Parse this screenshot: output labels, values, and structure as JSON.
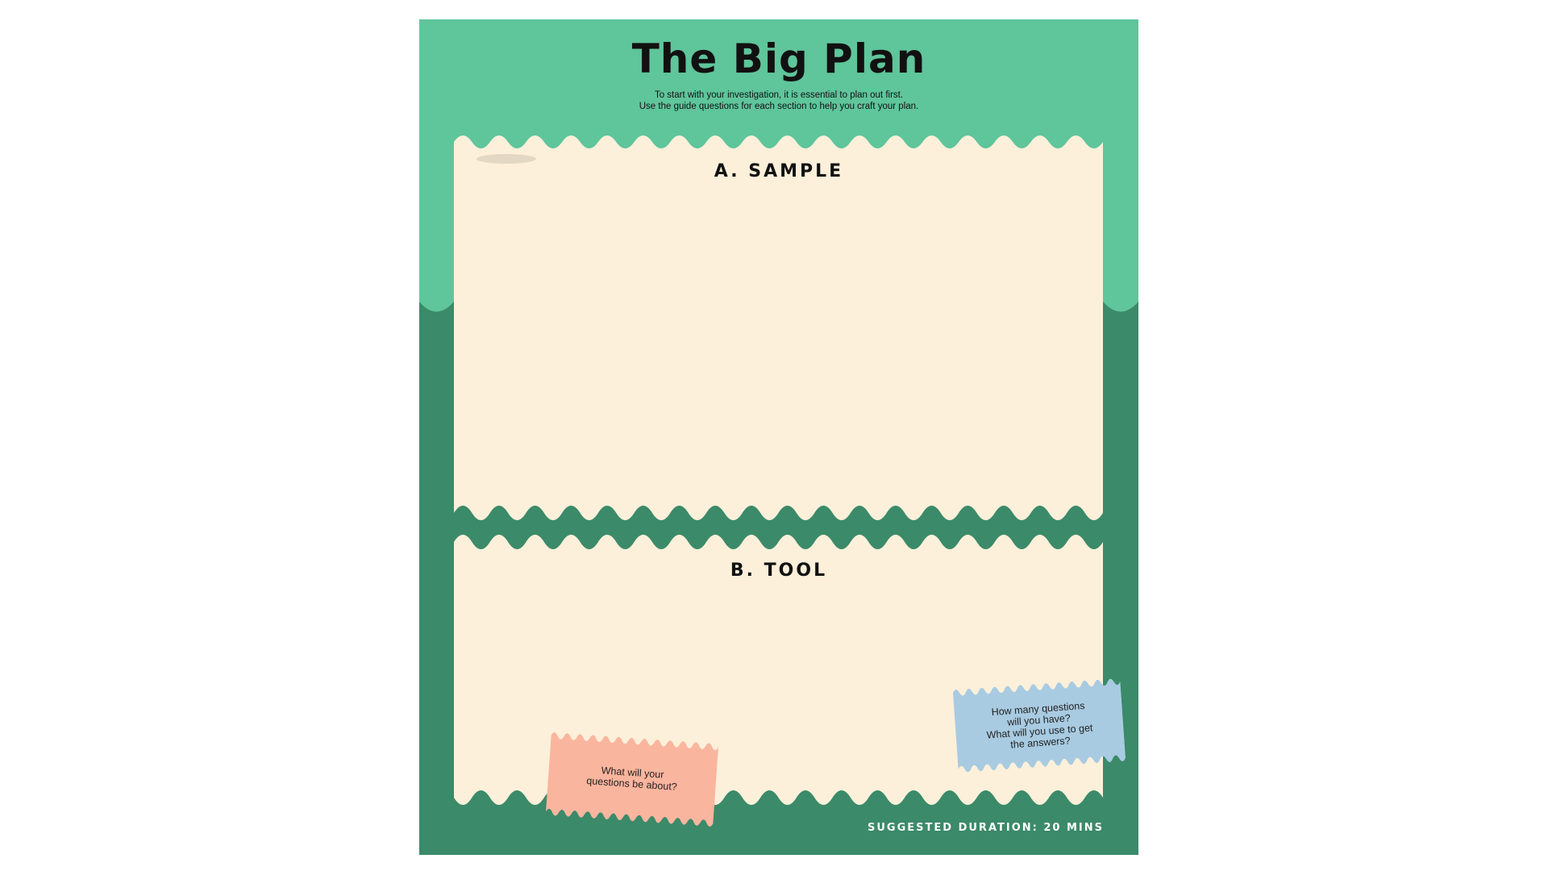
{
  "document": {
    "title": "The Big Plan",
    "intro_lines": [
      "To start with your investigation, it is essential to plan out first.",
      "Use the guide questions for each section to help you craft your plan."
    ],
    "sections": [
      {
        "label": "A. SAMPLE"
      },
      {
        "label": "B. TOOL"
      }
    ],
    "notes": {
      "pink": {
        "lines": [
          "What will your",
          "questions be about?"
        ]
      },
      "blue": {
        "lines": [
          "How many questions",
          "will you have?",
          "What will you use to get",
          "the answers?"
        ]
      }
    },
    "duration": "SUGGESTED DURATION: 20 MINS"
  },
  "colors": {
    "light_green": "#5fc59b",
    "dark_green": "#3b8a69",
    "cream": "#fcf0da",
    "pink_note": "#fab59e",
    "blue_note": "#a8cbe2"
  }
}
